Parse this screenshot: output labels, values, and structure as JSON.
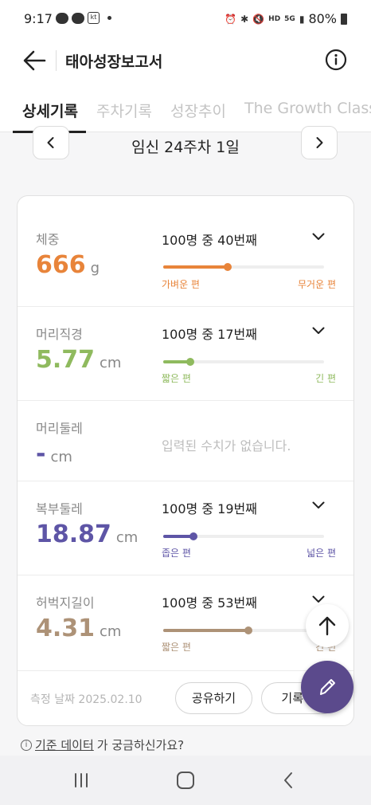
{
  "status_bar": {
    "time": "9:17",
    "battery": "80%",
    "network": "5G",
    "icons": [
      "talk-icon",
      "chat-icon",
      "kt-icon",
      "alarm-icon",
      "bluetooth-icon",
      "mute-icon",
      "hd-voice-icon",
      "signal-icon",
      "battery-icon"
    ]
  },
  "header": {
    "title": "태아성장보고서"
  },
  "tabs": [
    {
      "label": "상세기록",
      "active": true
    },
    {
      "label": "주차기록",
      "active": false
    },
    {
      "label": "성장추이",
      "active": false
    },
    {
      "label": "The Growth Class",
      "active": false
    }
  ],
  "week": {
    "label": "임신 24주차 1일"
  },
  "metrics": [
    {
      "label": "체중",
      "value": "666",
      "unit": "g",
      "rank": "100명 중 40번째",
      "low": "가벼운 편",
      "high": "무거운 편",
      "percent": 40,
      "color": "#e8843a"
    },
    {
      "label": "머리직경",
      "value": "5.77",
      "unit": "cm",
      "rank": "100명 중 17번째",
      "low": "짧은 편",
      "high": "긴 편",
      "percent": 17,
      "color": "#8fba5e"
    },
    {
      "label": "머리둘레",
      "value": "-",
      "unit": "cm",
      "empty": "입력된 수치가 없습니다.",
      "color": "#5e55a6"
    },
    {
      "label": "복부둘레",
      "value": "18.87",
      "unit": "cm",
      "rank": "100명 중 19번째",
      "low": "좁은 편",
      "high": "넓은 편",
      "percent": 19,
      "color": "#5e55a6"
    },
    {
      "label": "허벅지길이",
      "value": "4.31",
      "unit": "cm",
      "rank": "100명 중 53번째",
      "low": "짧은 편",
      "high": "긴 편",
      "percent": 53,
      "color": "#ad9277"
    }
  ],
  "footer": {
    "date": "측정 날짜 2025.02.10",
    "share": "공유하기",
    "record": "기록 편"
  },
  "help": {
    "link": "기준 데이터",
    "rest": "가 궁금하신가요?"
  }
}
